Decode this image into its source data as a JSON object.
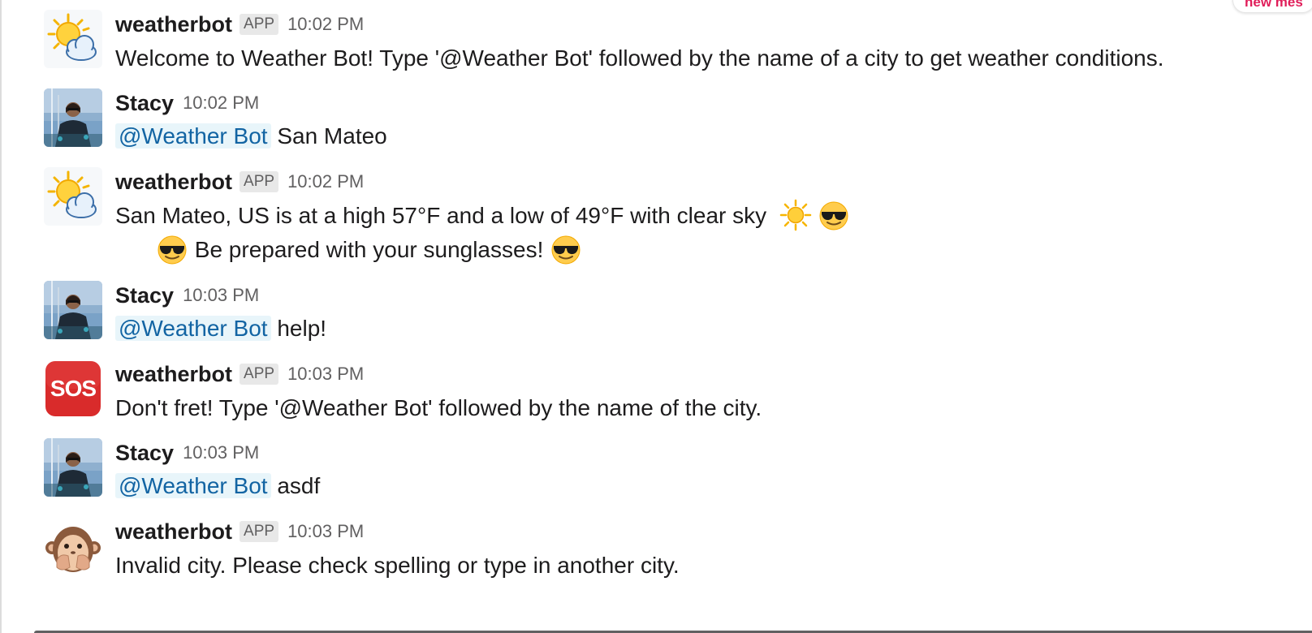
{
  "new_messages_label": "new mes",
  "colors": {
    "mention_bg": "#e8f5fa",
    "mention_text": "#1264a3",
    "badge_bg": "#e8e8e8",
    "new_messages_text": "#e01e5a"
  },
  "messages": [
    {
      "sender": "weatherbot",
      "badge": "APP",
      "time": "10:02 PM",
      "avatar_icon": "sun-behind-cloud-icon",
      "text": "Welcome to Weather Bot! Type '@Weather Bot' followed by the name of a city to get weather conditions."
    },
    {
      "sender": "Stacy",
      "time": "10:02 PM",
      "avatar_icon": "user-photo-avatar",
      "mention": "@Weather Bot",
      "text": "San Mateo"
    },
    {
      "sender": "weatherbot",
      "badge": "APP",
      "time": "10:02 PM",
      "avatar_icon": "sun-behind-cloud-icon",
      "line1": "San Mateo, US is at a high 57°F and a low of 49°F with clear sky",
      "line1_emojis": [
        "sun-icon",
        "sunglasses-face-icon"
      ],
      "line2": "Be prepared with your sunglasses!",
      "line2_emojis": [
        "sunglasses-face-icon",
        "sunglasses-face-icon"
      ]
    },
    {
      "sender": "Stacy",
      "time": "10:03 PM",
      "avatar_icon": "user-photo-avatar",
      "mention": "@Weather Bot",
      "text": "help!"
    },
    {
      "sender": "weatherbot",
      "badge": "APP",
      "time": "10:03 PM",
      "avatar_icon": "sos-icon",
      "avatar_label": "SOS",
      "text": "Don't fret! Type '@Weather Bot' followed by the name of the city."
    },
    {
      "sender": "Stacy",
      "time": "10:03 PM",
      "avatar_icon": "user-photo-avatar",
      "mention": "@Weather Bot",
      "text": "asdf"
    },
    {
      "sender": "weatherbot",
      "badge": "APP",
      "time": "10:03 PM",
      "avatar_icon": "see-no-evil-monkey-icon",
      "text": "Invalid city. Please check spelling or type in another city."
    }
  ]
}
